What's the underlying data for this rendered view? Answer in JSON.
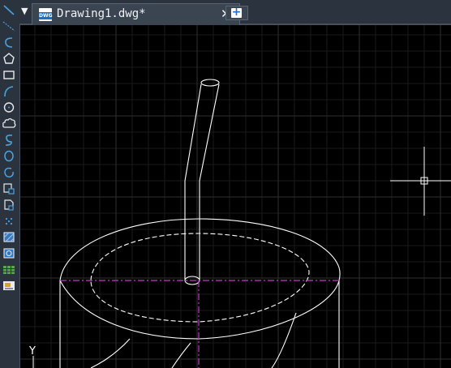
{
  "tabs": {
    "menu_arrow": "▼",
    "active_tab_title": "Drawing1.dwg*",
    "file_icon_text": "DWG",
    "close_glyph": "✕",
    "new_tab_glyph": "+"
  },
  "toolbar": {
    "tools": [
      "line-icon",
      "construction-line-icon",
      "polyline-icon",
      "polygon-icon",
      "rectangle-icon",
      "arc-icon",
      "circle-icon",
      "revision-cloud-icon",
      "spline-icon",
      "ellipse-icon",
      "ellipse-arc-icon",
      "insert-block-icon",
      "make-block-icon",
      "point-icon",
      "hatch-icon",
      "region-icon",
      "table-icon",
      "multiline-text-icon"
    ]
  },
  "canvas": {
    "background_color": "#000000",
    "grid_color": "#262626",
    "geometry_color": "#ffffff",
    "centerline_color": "#cc33cc",
    "ucs_axis_label": "Y"
  }
}
